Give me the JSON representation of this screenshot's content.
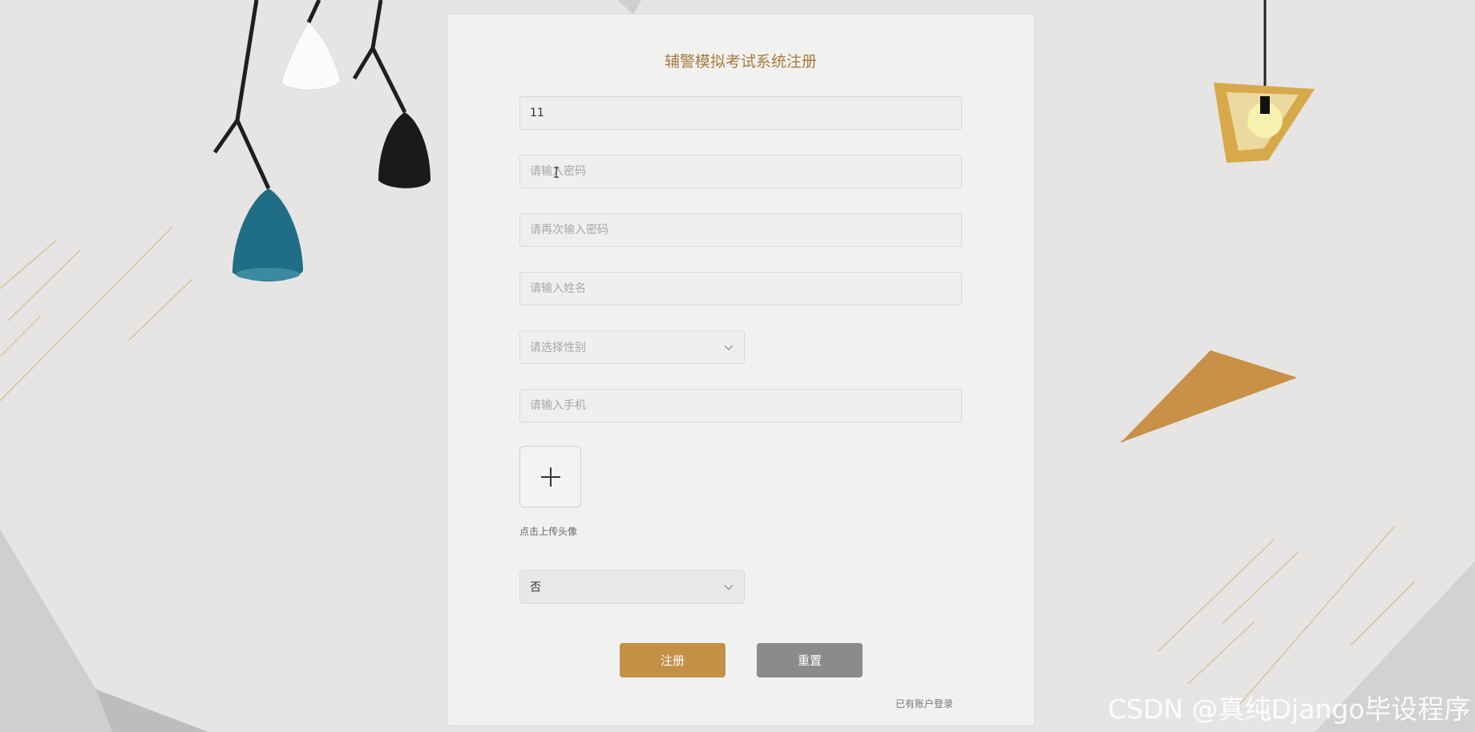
{
  "form": {
    "title": "辅警模拟考试系统注册",
    "account_value": "11",
    "password_placeholder": "请输入密码",
    "password_confirm_placeholder": "请再次输入密码",
    "name_placeholder": "请输入姓名",
    "gender_placeholder": "请选择性别",
    "phone_placeholder": "请输入手机",
    "upload_label": "点击上传头像",
    "select_value": "否",
    "register_button": "注册",
    "reset_button": "重置",
    "login_link": "已有账户登录"
  },
  "watermark": "CSDN @真纯Django毕设程序",
  "icons": [
    "plus-icon",
    "chevron-down-icon",
    "text-cursor-icon"
  ],
  "colors": {
    "accent": "#c39045",
    "title": "#a67c3d",
    "reset": "#8b8b8b",
    "background": "#e6e5e3"
  }
}
